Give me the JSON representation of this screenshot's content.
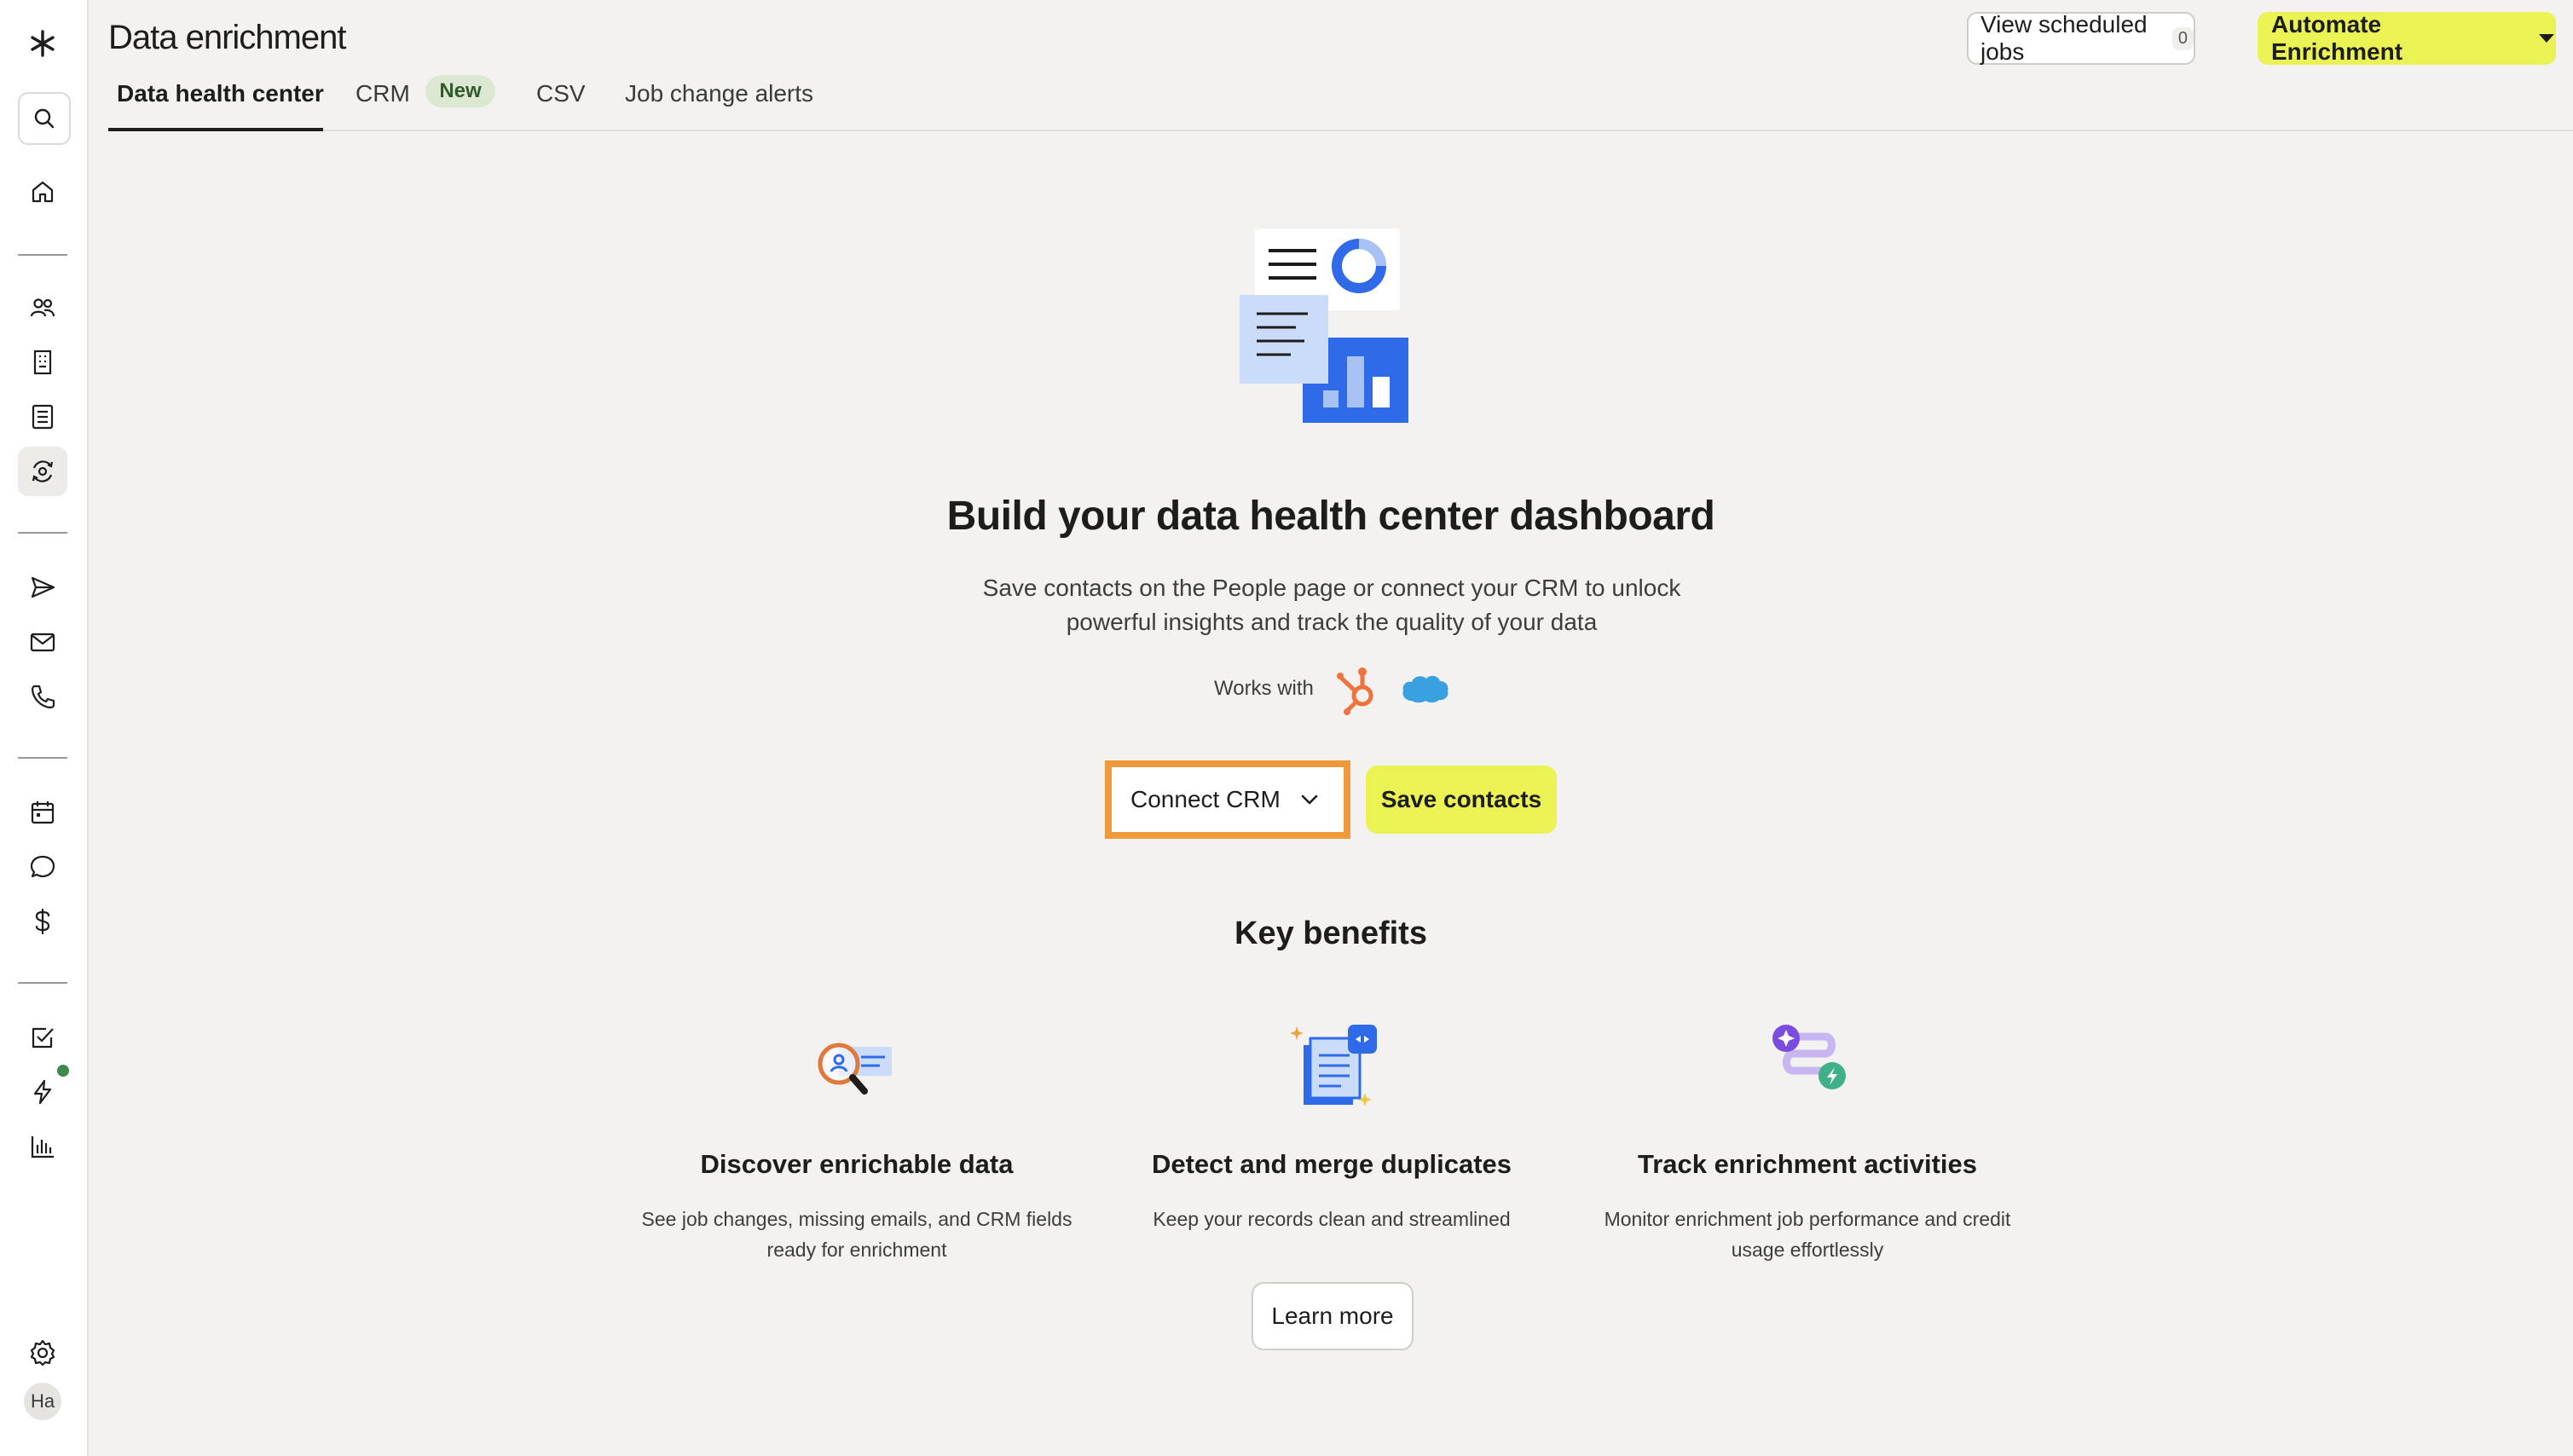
{
  "header": {
    "title": "Data enrichment",
    "scheduled_jobs_label": "View scheduled jobs",
    "scheduled_jobs_count": "0",
    "automate_label": "Automate Enrichment"
  },
  "tabs": [
    {
      "label": "Data health center",
      "active": true
    },
    {
      "label": "CRM",
      "badge": "New",
      "active": false
    },
    {
      "label": "CSV",
      "active": false
    },
    {
      "label": "Job change alerts",
      "active": false
    }
  ],
  "sidebar": {
    "icons": [
      "logo-icon",
      "search-icon",
      "home-icon",
      "people-icon",
      "companies-icon",
      "lists-icon",
      "data-health-icon",
      "sequences-icon",
      "email-icon",
      "phone-icon",
      "meetings-icon",
      "conversations-icon",
      "deals-icon",
      "tasks-icon",
      "workflows-icon",
      "analytics-icon",
      "settings-icon"
    ],
    "avatar_initials": "Ha",
    "active": "data-health-icon"
  },
  "hero": {
    "headline": "Build your data health center dashboard",
    "subtitle_line1": "Save contacts on the People page or connect your CRM to unlock",
    "subtitle_line2": "powerful insights and track the quality of your data",
    "works_with": "Works with",
    "connect_crm_label": "Connect CRM",
    "save_contacts_label": "Save contacts"
  },
  "benefits": {
    "heading": "Key benefits",
    "items": [
      {
        "title": "Discover enrichable data",
        "line1": "See job changes, missing emails, and CRM fields",
        "line2": "ready for enrichment"
      },
      {
        "title": "Detect and merge duplicates",
        "line1": "Keep your records clean and streamlined",
        "line2": ""
      },
      {
        "title": "Track enrichment activities",
        "line1": "Monitor enrichment job performance and credit",
        "line2": "usage effortlessly"
      }
    ],
    "learn_more_label": "Learn more"
  },
  "colors": {
    "accent_yellow": "#ebf254",
    "highlight_orange": "#ef9a3a",
    "brand_blue": "#2f6be8",
    "hubspot_orange": "#f0733e",
    "salesforce_blue": "#3aa1e0"
  }
}
